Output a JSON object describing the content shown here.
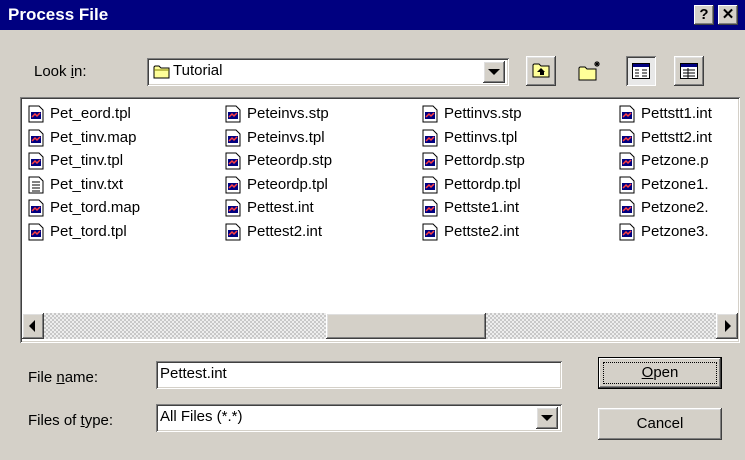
{
  "window": {
    "title": "Process File",
    "help_label": "?",
    "close_label": "✕"
  },
  "look_in": {
    "label_pre": "Look ",
    "label_accel": "i",
    "label_post": "n:",
    "value": "Tutorial"
  },
  "toolbar": {
    "up_icon": "up-one-level-icon",
    "new_folder_icon": "new-folder-icon",
    "list_icon": "list-view-icon",
    "details_icon": "details-view-icon"
  },
  "files": [
    {
      "name": "Pet_eord.tpl",
      "icon": "document-icon"
    },
    {
      "name": "Pet_tinv.map",
      "icon": "document-icon"
    },
    {
      "name": "Pet_tinv.tpl",
      "icon": "document-icon"
    },
    {
      "name": "Pet_tinv.txt",
      "icon": "text-file-icon"
    },
    {
      "name": "Pet_tord.map",
      "icon": "document-icon"
    },
    {
      "name": "Pet_tord.tpl",
      "icon": "document-icon"
    },
    {
      "name": "Peteinvs.stp",
      "icon": "document-icon"
    },
    {
      "name": "Peteinvs.tpl",
      "icon": "document-icon"
    },
    {
      "name": "Peteordp.stp",
      "icon": "document-icon"
    },
    {
      "name": "Peteordp.tpl",
      "icon": "document-icon"
    },
    {
      "name": "Pettest.int",
      "icon": "document-icon"
    },
    {
      "name": "Pettest2.int",
      "icon": "document-icon"
    },
    {
      "name": "Pettinvs.stp",
      "icon": "document-icon"
    },
    {
      "name": "Pettinvs.tpl",
      "icon": "document-icon"
    },
    {
      "name": "Pettordp.stp",
      "icon": "document-icon"
    },
    {
      "name": "Pettordp.tpl",
      "icon": "document-icon"
    },
    {
      "name": "Pettste1.int",
      "icon": "document-icon"
    },
    {
      "name": "Pettste2.int",
      "icon": "document-icon"
    },
    {
      "name": "Pettstt1.int",
      "icon": "document-icon"
    },
    {
      "name": "Pettstt2.int",
      "icon": "document-icon"
    },
    {
      "name": "Petzone.p",
      "icon": "document-icon"
    },
    {
      "name": "Petzone1.",
      "icon": "document-icon"
    },
    {
      "name": "Petzone2.",
      "icon": "document-icon"
    },
    {
      "name": "Petzone3.",
      "icon": "document-icon"
    }
  ],
  "file_name": {
    "label_pre": "File ",
    "label_accel": "n",
    "label_post": "ame:",
    "value": "Pettest.int"
  },
  "file_type": {
    "label_pre": "Files of ",
    "label_accel": "t",
    "label_post": "ype:",
    "value": "All Files (*.*)"
  },
  "buttons": {
    "open_accel": "O",
    "open_rest": "pen",
    "cancel": "Cancel"
  }
}
